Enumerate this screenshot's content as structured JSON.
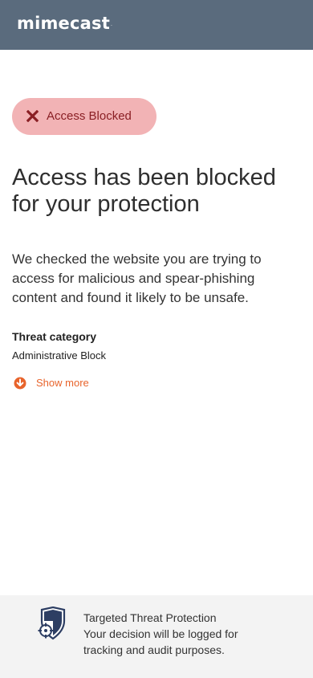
{
  "header": {
    "logo_text": "mimecast",
    "logo_mark": "·",
    "background_color": "#5a6b7d"
  },
  "status_badge": {
    "label": "Access Blocked",
    "icon": "close-icon",
    "background_color": "#f2b3b5",
    "text_color": "#8a1f24"
  },
  "main": {
    "title": "Access has been blocked for your protection",
    "description": "We checked the website you are trying to access for malicious and spear-phishing content and found it likely to be unsafe.",
    "threat_category_heading": "Threat category",
    "threat_category_value": "Administrative Block",
    "show_more_label": "Show more",
    "show_more_icon": "arrow-down-circle-icon",
    "accent_color": "#e8642c"
  },
  "footer": {
    "icon": "shield-crosshair-icon",
    "line1": "Targeted Threat Protection",
    "line2": "Your decision will be logged for",
    "line3": "tracking and audit purposes.",
    "background_color": "#f3f3f3"
  }
}
